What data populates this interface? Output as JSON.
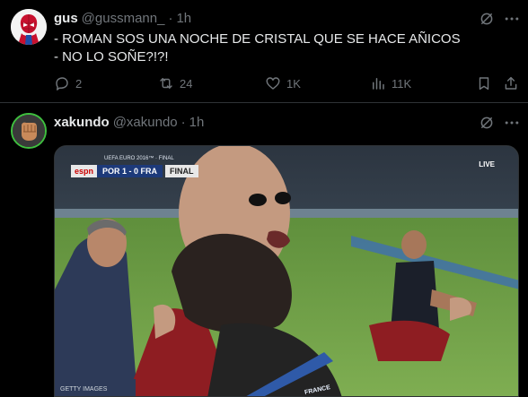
{
  "tweets": [
    {
      "name": "gus",
      "handle": "@gussmann_",
      "separator": "·",
      "time": "1h",
      "lines": [
        "- ROMAN SOS UNA NOCHE DE CRISTAL QUE SE HACE AÑICOS",
        "- NO LO SOÑE?!?!"
      ],
      "actions": {
        "replies": "2",
        "retweets": "24",
        "likes": "1K",
        "views": "11K"
      },
      "icons": {
        "grok": "grok-icon",
        "more": "more-icon",
        "reply": "reply-icon",
        "retweet": "retweet-icon",
        "like": "heart-icon",
        "views": "views-icon",
        "bookmark": "bookmark-icon",
        "share": "share-icon"
      }
    },
    {
      "name": "xakundo",
      "handle": "@xakundo",
      "separator": "·",
      "time": "1h",
      "media": {
        "scoreboard": {
          "top": "UEFA EURO 2016™ · FINAL",
          "network": "espn",
          "teams": "POR 1 - 0 FRA",
          "status": "FINAL"
        },
        "live": "LIVE",
        "watermark": "GETTY IMAGES",
        "lanyard": "FRANCE"
      }
    }
  ],
  "colors": {
    "background": "#000000",
    "text": "#e7e9ea",
    "muted": "#71767b",
    "divider": "#2f3336",
    "avatar_ring": "#3fbf3f"
  }
}
